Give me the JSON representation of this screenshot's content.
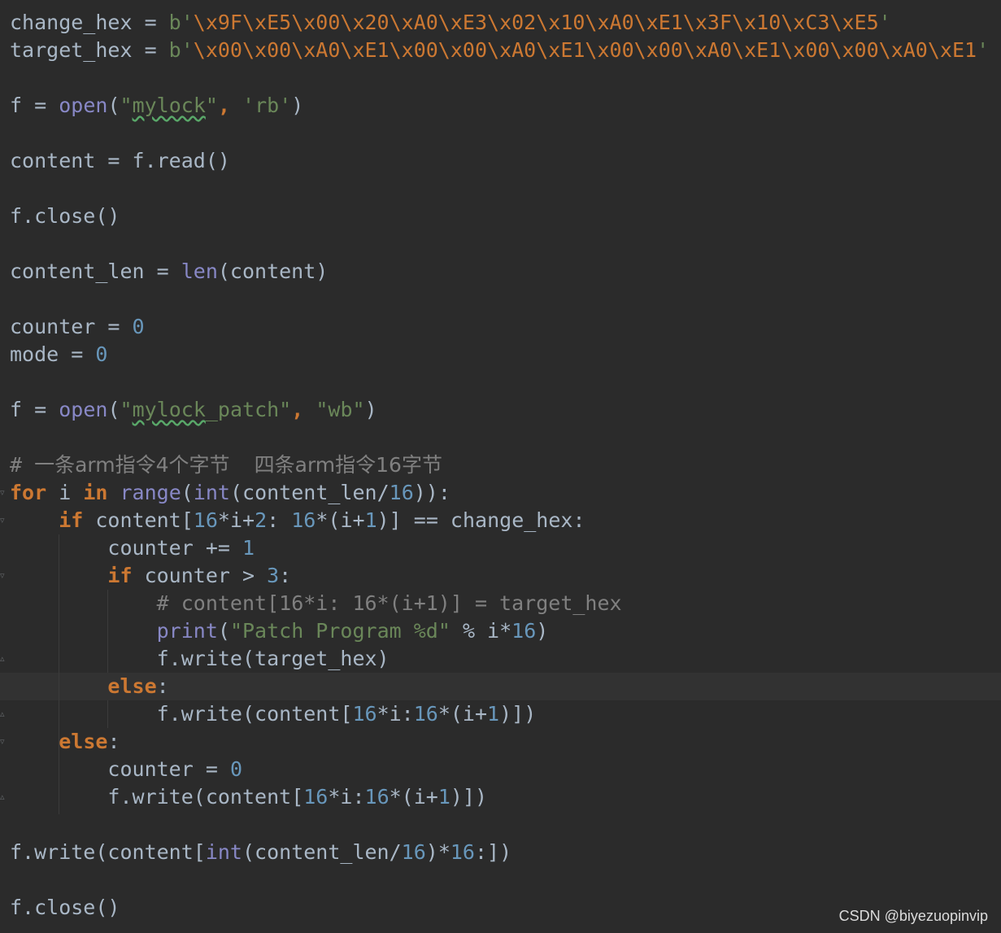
{
  "code": {
    "L1_var": "change_hex",
    "L1_op": " = ",
    "L1_prefix": "b'",
    "L1_bytes": "\\x9F\\xE5\\x00\\x20\\xA0\\xE3\\x02\\x10\\xA0\\xE1\\x3F\\x10\\xC3\\xE5",
    "L1_end": "'",
    "L2_var": "target_hex",
    "L2_op": " = ",
    "L2_prefix": "b'",
    "L2_bytes": "\\x00\\x00\\xA0\\xE1\\x00\\x00\\xA0\\xE1\\x00\\x00\\xA0\\xE1\\x00\\x00\\xA0\\xE1",
    "L2_end": "'",
    "L4_pre": "f = ",
    "L4_fn": "open",
    "L4_p1": "(",
    "L4_q1": "\"",
    "L4_word": "mylock",
    "L4_q2": "\"",
    "L4_sep": ", ",
    "L4_mode": "'rb'",
    "L4_p2": ")",
    "L6": "content = f.read()",
    "L8": "f.close()",
    "L10_pre": "content_len = ",
    "L10_fn": "len",
    "L10_post": "(content)",
    "L12_pre": "counter = ",
    "L12_num": "0",
    "L13_pre": "mode = ",
    "L13_num": "0",
    "L15_pre": "f = ",
    "L15_fn": "open",
    "L15_p1": "(",
    "L15_q1": "\"",
    "L15_word": "mylock",
    "L15_rest": "_patch\"",
    "L15_sep": ", ",
    "L15_mode": "\"wb\"",
    "L15_p2": ")",
    "L17_hash": "# ",
    "L17_text1": "一条arm指令4个字节",
    "L17_gap": "  ",
    "L17_text2": "四条arm指令16字节",
    "L18_for": "for",
    "L18_i": " i ",
    "L18_in": "in",
    "L18_sp": " ",
    "L18_range": "range",
    "L18_p1": "(",
    "L18_int": "int",
    "L18_mid": "(content_len/",
    "L18_n": "16",
    "L18_end": ")):",
    "L19_ind": "    ",
    "L19_if": "if",
    "L19_a": " content[",
    "L19_n1": "16",
    "L19_b": "*i+",
    "L19_n2": "2",
    "L19_c": ": ",
    "L19_n3": "16",
    "L19_d": "*(i+",
    "L19_n4": "1",
    "L19_e": ")] == change_hex:",
    "L20_ind": "        ",
    "L20_a": "counter += ",
    "L20_n": "1",
    "L21_ind": "        ",
    "L21_if": "if",
    "L21_a": " counter > ",
    "L21_n": "3",
    "L21_b": ":",
    "L22_ind": "            ",
    "L22_cmt": "# content[16*i: 16*(i+1)] = target_hex",
    "L23_ind": "            ",
    "L23_fn": "print",
    "L23_p1": "(",
    "L23_str": "\"Patch Program %d\"",
    "L23_a": " % i*",
    "L23_n": "16",
    "L23_p2": ")",
    "L24_ind": "            ",
    "L24": "f.write(target_hex)",
    "L25_ind": "        ",
    "L25_else": "else",
    "L25_colon": ":",
    "L26_ind": "            ",
    "L26_a": "f.write(content[",
    "L26_n1": "16",
    "L26_b": "*i:",
    "L26_n2": "16",
    "L26_c": "*(i+",
    "L26_n3": "1",
    "L26_d": ")])",
    "L27_ind": "    ",
    "L27_else": "else",
    "L27_colon": ":",
    "L28_ind": "        ",
    "L28_a": "counter = ",
    "L28_n": "0",
    "L29_ind": "        ",
    "L29_a": "f.write(content[",
    "L29_n1": "16",
    "L29_b": "*i:",
    "L29_n2": "16",
    "L29_c": "*(i+",
    "L29_n3": "1",
    "L29_d": ")])",
    "L31_a": "f.write(content[",
    "L31_int": "int",
    "L31_b": "(content_len/",
    "L31_n1": "16",
    "L31_c": ")*",
    "L31_n2": "16",
    "L31_d": ":])",
    "L33": "f.close()"
  },
  "watermark": "CSDN @biyezuopinvip",
  "colors": {
    "background": "#2b2b2b",
    "current_line": "#323232",
    "default_text": "#a9b7c6",
    "keyword": "#cc7832",
    "builtin": "#8888c6",
    "number": "#6897bb",
    "string": "#6a8759",
    "comment": "#808080"
  }
}
